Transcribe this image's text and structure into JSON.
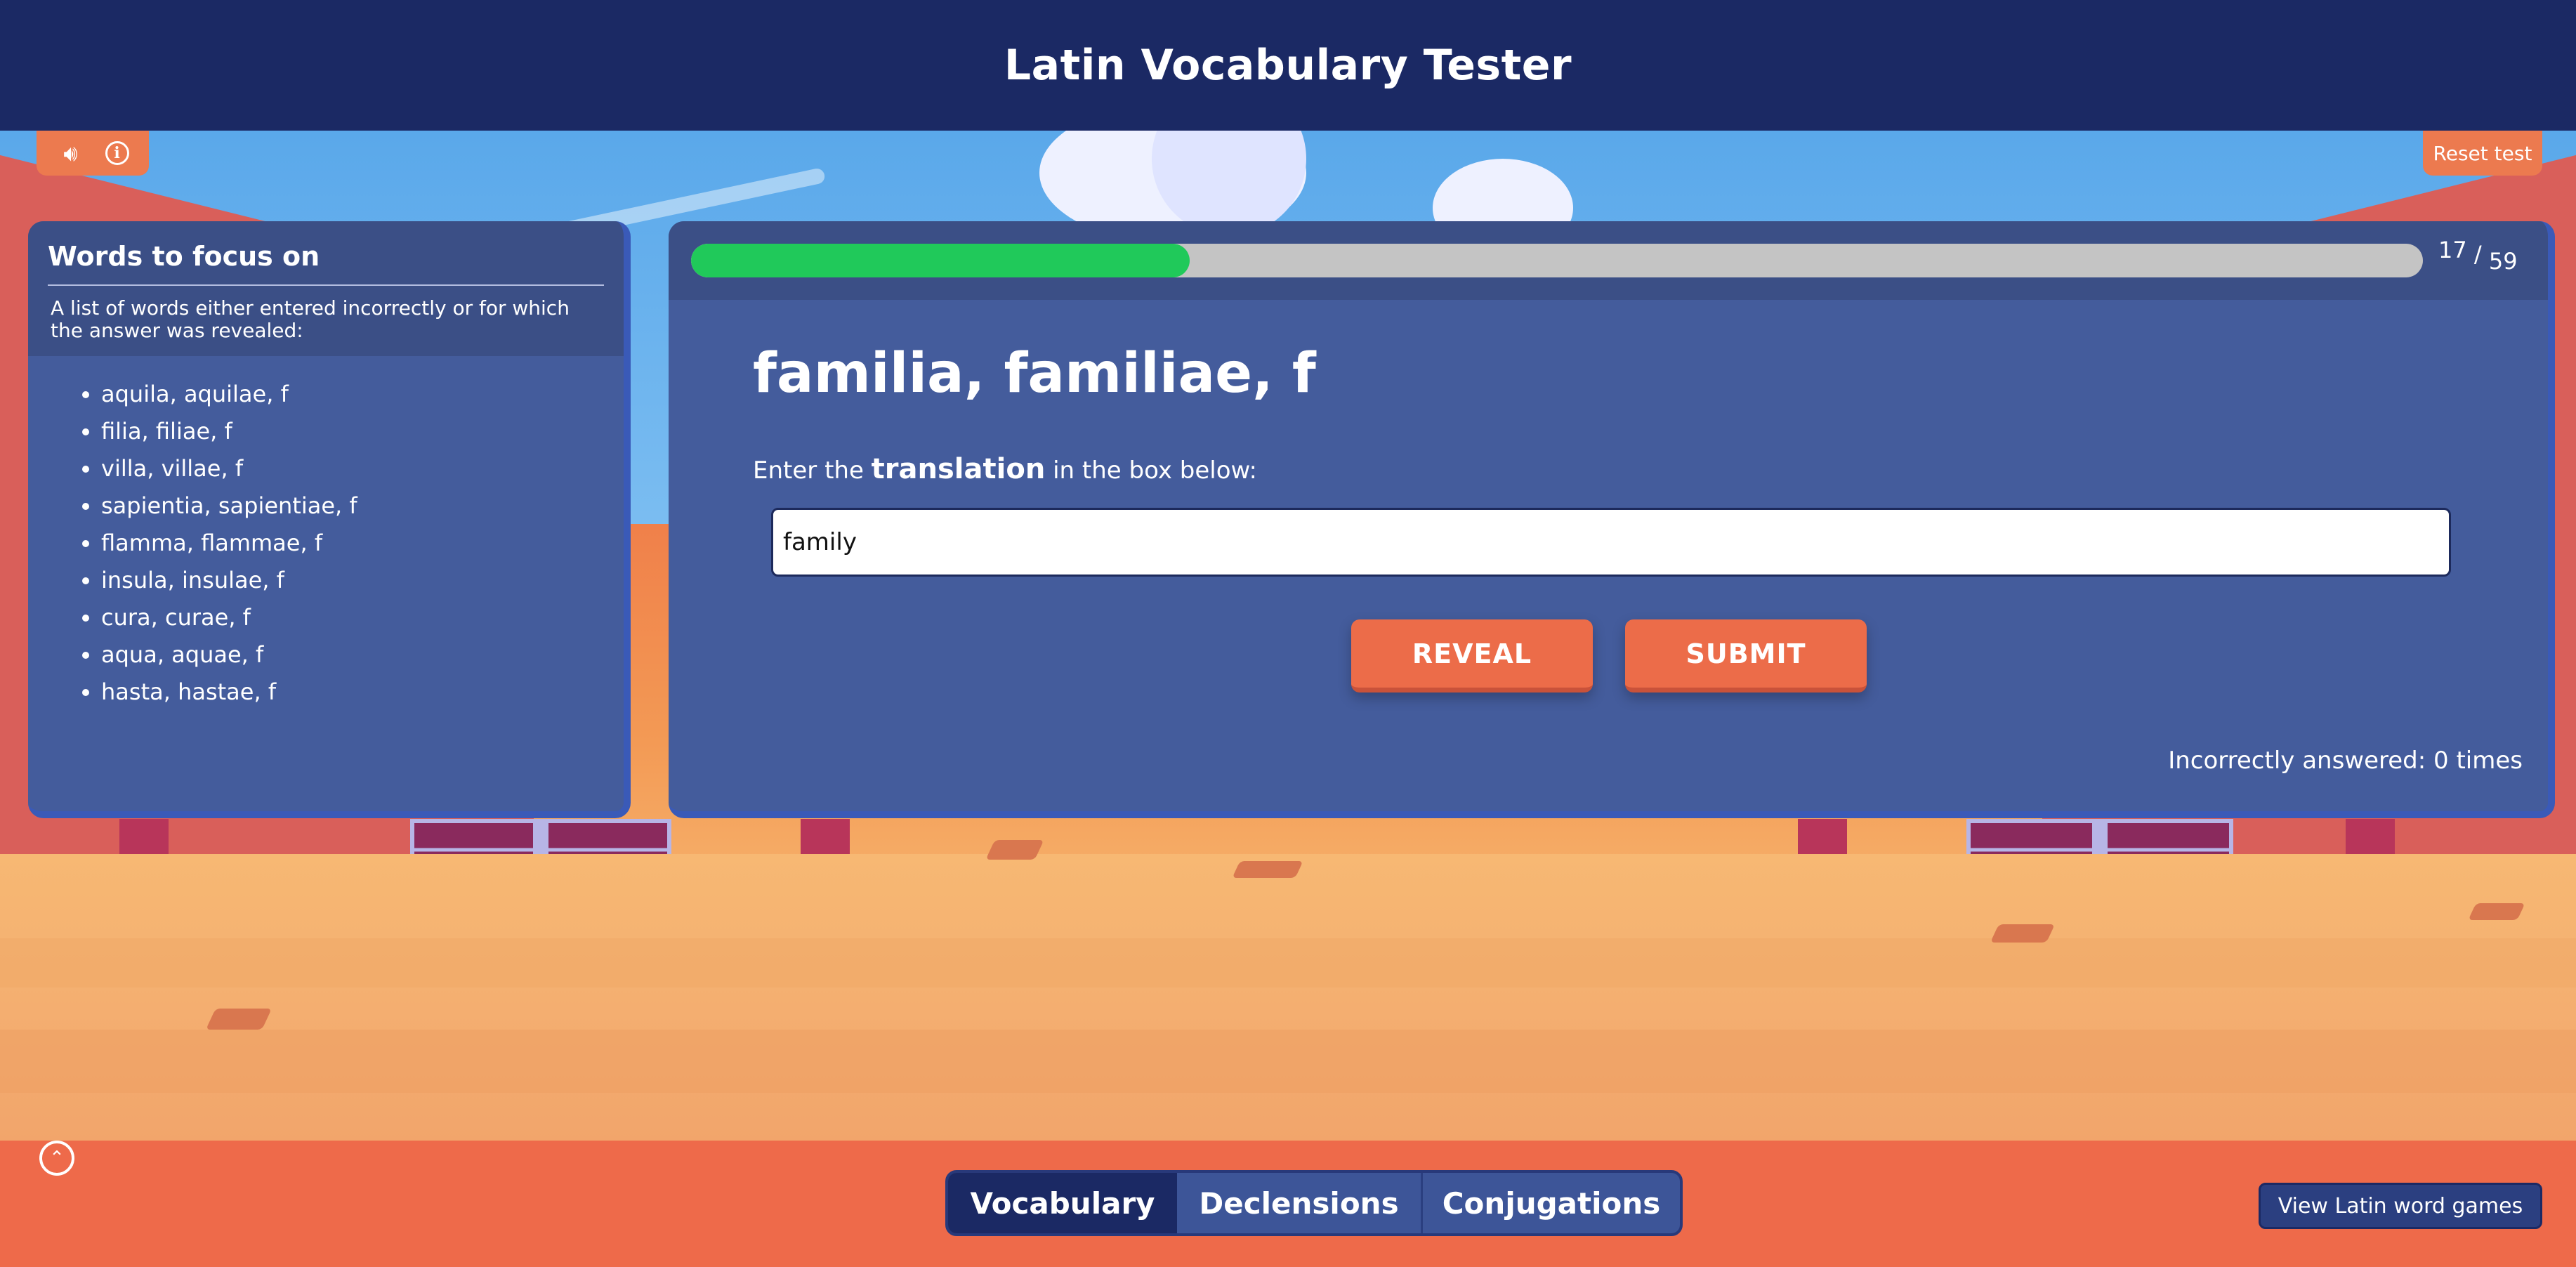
{
  "header": {
    "title": "Latin Vocabulary Tester"
  },
  "toolbar": {
    "sound_icon": "speaker-icon",
    "info_icon": "info-icon",
    "reset_label": "Reset test"
  },
  "focus_panel": {
    "title": "Words to focus on",
    "description": "A list of words either entered incorrectly or for which the answer was revealed:",
    "words": [
      "aquila, aquilae, f",
      "filia, filiae, f",
      "villa, villae, f",
      "sapientia, sapientiae, f",
      "flamma, flammae, f",
      "insula, insulae, f",
      "cura, curae, f",
      "aqua, aquae, f",
      "hasta, hastae, f"
    ]
  },
  "quiz": {
    "progress_current": "17",
    "progress_separator": "/",
    "progress_total": "59",
    "progress_fraction": 0.288,
    "word": "familia, familiae, f",
    "prompt_before": "Enter the ",
    "prompt_bold": "translation",
    "prompt_after": " in the box below:",
    "answer_value": "family",
    "reveal_label": "REVEAL",
    "submit_label": "SUBMIT",
    "incorrect_text": "Incorrectly answered: 0 times"
  },
  "footer": {
    "tabs": [
      "Vocabulary",
      "Declensions",
      "Conjugations"
    ],
    "active_tab": "Vocabulary",
    "games_label": "View Latin word games",
    "scroll_up_icon": "chevron-up-icon"
  },
  "colors": {
    "header_bg": "#1b2964",
    "panel_bg": "#445c9c",
    "accent": "#ec6c49",
    "progress_fill": "#20c95a"
  }
}
